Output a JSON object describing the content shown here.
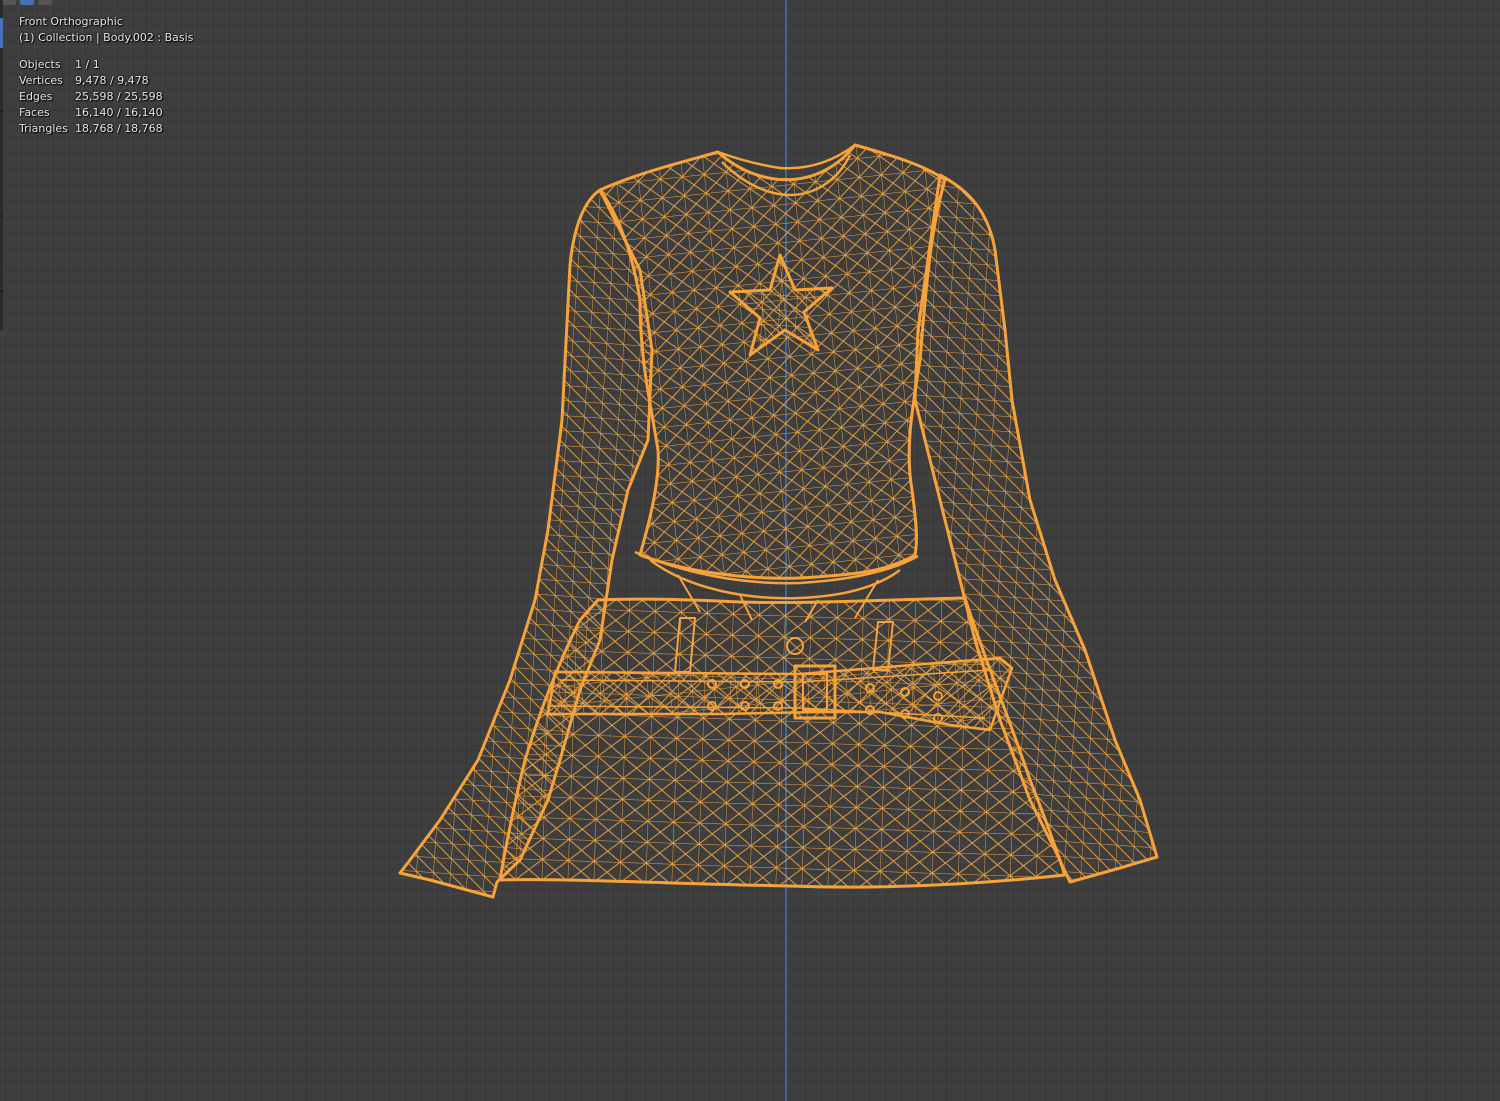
{
  "viewport": {
    "view_name": "Front Orthographic",
    "object_info": "(1) Collection | Body.002 : Basis",
    "stats": [
      {
        "label": "Objects",
        "value": "1 / 1"
      },
      {
        "label": "Vertices",
        "value": "9,478 / 9,478"
      },
      {
        "label": "Edges",
        "value": "25,598 / 25,598"
      },
      {
        "label": "Faces",
        "value": "16,140 / 16,140"
      },
      {
        "label": "Triangles",
        "value": "18,768 / 18,768"
      }
    ]
  },
  "colors": {
    "background": "#3d3d3d",
    "wire": "#f0a440",
    "wire_edge": "#f7a33a",
    "axis_y": "#3d6fa8",
    "active_tab": "#4772b3"
  },
  "icons": [
    "wireframe-mesh",
    "star-emblem",
    "belt-buckle"
  ]
}
